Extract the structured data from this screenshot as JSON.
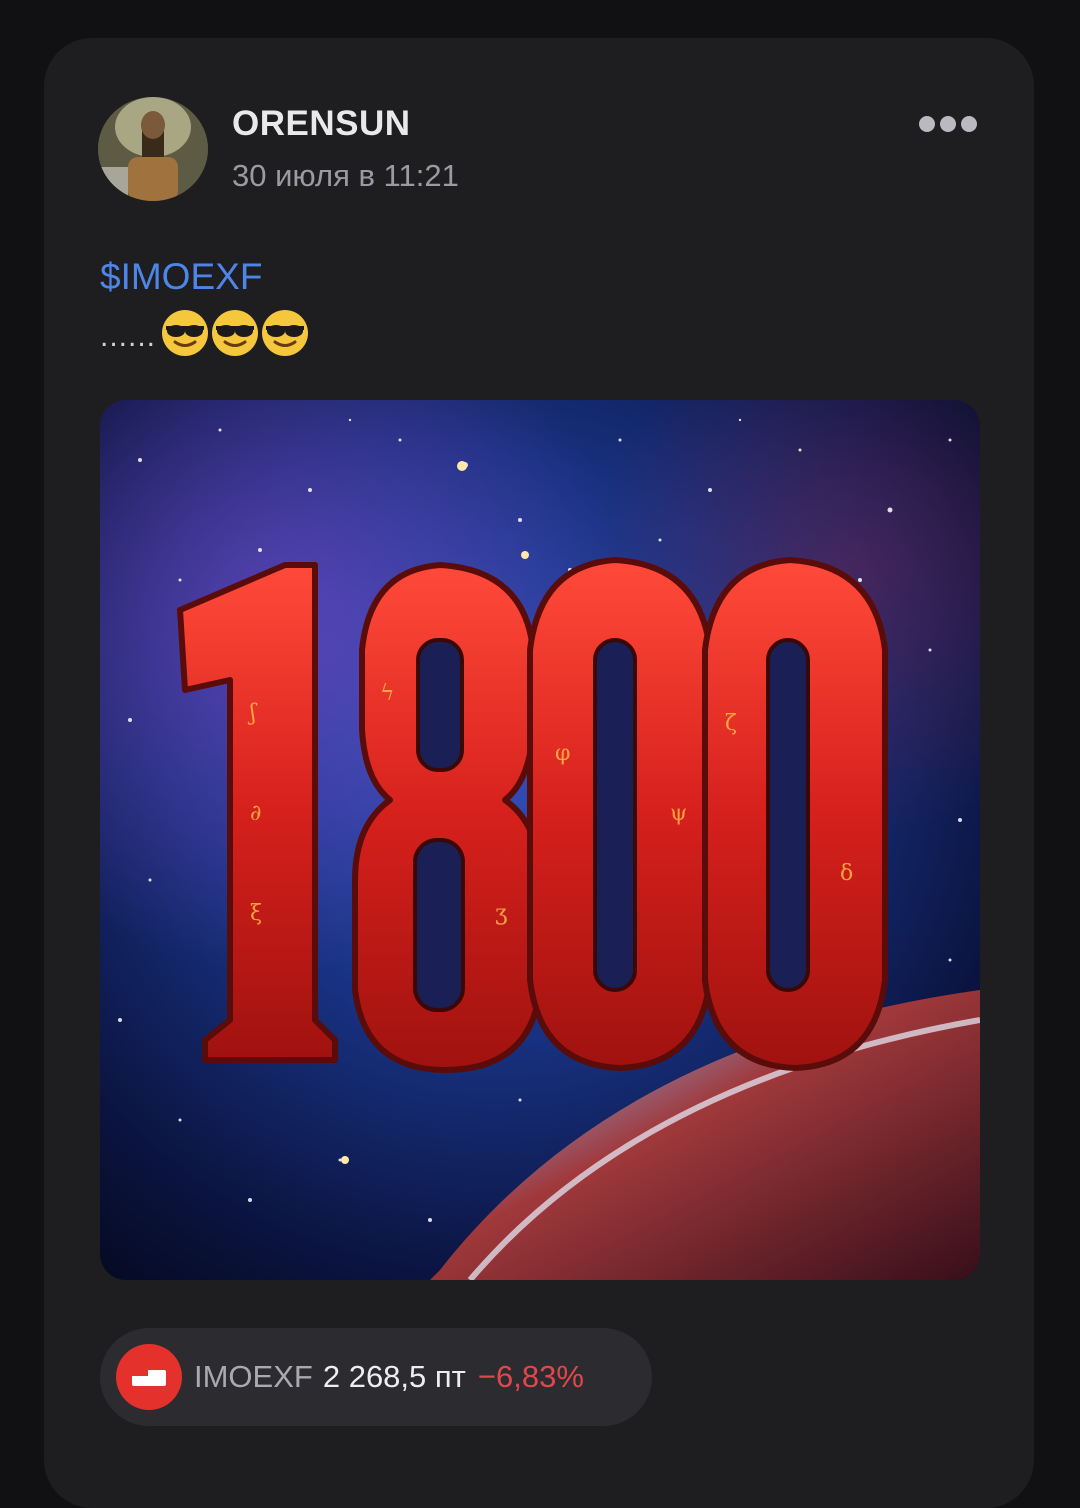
{
  "post": {
    "author": "ORENSUN",
    "date": "30 июля в 11:21",
    "ticker_tag": "$IMOEXF",
    "text_dots": "......",
    "emojis": [
      "smiling-face-with-sunglasses",
      "smiling-face-with-sunglasses",
      "smiling-face-with-sunglasses"
    ],
    "image_text": "1800",
    "more_icon": "more-dots-icon"
  },
  "quote": {
    "ticker": "IMOEXF",
    "price": "2 268,5 пт",
    "change": "−6,83%",
    "change_color": "#e1464b",
    "logo_color": "#e4312b"
  },
  "colors": {
    "background": "#111113",
    "card": "#1e1e21",
    "link": "#4e86e8"
  }
}
